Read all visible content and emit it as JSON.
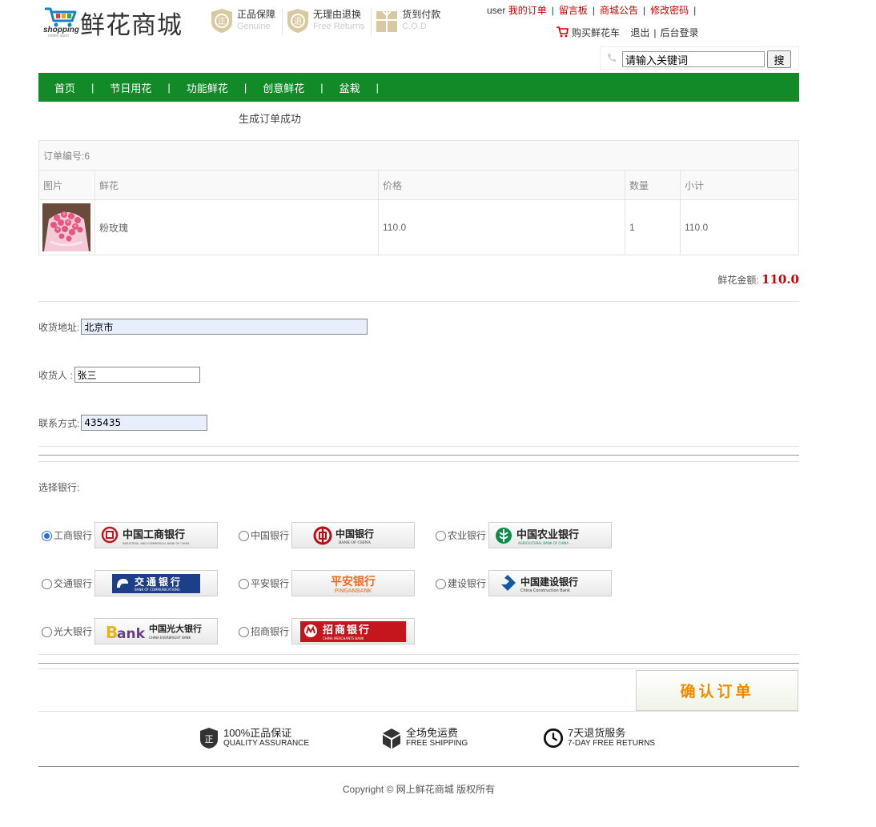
{
  "header": {
    "logo_word": "shopping",
    "logo_tag": "online sport",
    "brand": "鲜花商城",
    "promises": [
      {
        "title": "正品保障",
        "sub": "Genuine",
        "icon": "genuine-badge-icon"
      },
      {
        "title": "无理由退换",
        "sub": "Free Returns",
        "icon": "returns-badge-icon"
      },
      {
        "title": "货到付款",
        "sub": "C.O.D",
        "icon": "cod-badge-icon"
      }
    ],
    "username": "user",
    "top_links": [
      "我的订单",
      "留言板",
      "商城公告",
      "修改密码"
    ],
    "cart_link": "购买鲜花车",
    "logout": "退出",
    "admin": "后台登录",
    "search_value": "请输入关键词",
    "search_button": "搜"
  },
  "nav": [
    "首页",
    "节日用花",
    "功能鲜花",
    "创意鲜花",
    "盆栽"
  ],
  "order": {
    "success_msg": "生成订单成功",
    "order_no": "订单编号:6",
    "columns": [
      "图片",
      "鲜花",
      "价格",
      "数量",
      "小计"
    ],
    "items": [
      {
        "name": "粉玫瑰",
        "price": "110.0",
        "qty": "1",
        "subtotal": "110.0"
      }
    ],
    "total_label": "鲜花金额:",
    "total_value": "110.0"
  },
  "form": {
    "address_label": "收货地址:",
    "address_value": "北京市",
    "receiver_label": "收货人 :",
    "receiver_value": "张三",
    "contact_label": "联系方式:",
    "contact_value": "435435"
  },
  "banks": {
    "choose_label": "选择银行:",
    "list": [
      {
        "name": "工商银行",
        "selected": true,
        "logo": "icbc-logo",
        "logo_text": "中国工商银行",
        "logo_sub": "INDUSTRIAL AND COMMERCIAL BANK OF CHINA"
      },
      {
        "name": "中国银行",
        "selected": false,
        "logo": "boc-logo",
        "logo_text": "中国银行",
        "logo_sub": "BANK OF CHINA"
      },
      {
        "name": "农业银行",
        "selected": false,
        "logo": "abc-logo",
        "logo_text": "中国农业银行",
        "logo_sub": "AGRICULTURAL BANK OF CHINA"
      },
      {
        "name": "交通银行",
        "selected": false,
        "logo": "bocom-logo",
        "logo_text": "交通银行",
        "logo_sub": "BANK OF COMMUNICATIONS"
      },
      {
        "name": "平安银行",
        "selected": false,
        "logo": "pingan-logo",
        "logo_text": "平安银行",
        "logo_sub": "PINGANBANK"
      },
      {
        "name": "建设银行",
        "selected": false,
        "logo": "ccb-logo",
        "logo_text": "中国建设银行",
        "logo_sub": "China Construction Bank"
      },
      {
        "name": "光大银行",
        "selected": false,
        "logo": "ceb-logo",
        "logo_text": "中国光大银行",
        "logo_sub": "CHINA EVERBRIGHT BANK"
      },
      {
        "name": "招商银行",
        "selected": false,
        "logo": "cmb-logo",
        "logo_text": "招商银行",
        "logo_sub": "CHINA MERCHANTS BANK"
      }
    ]
  },
  "confirm_button": "确认订单",
  "services": [
    {
      "title": "100%正品保证",
      "sub": "QUALITY ASSURANCE",
      "icon": "quality-shield-icon"
    },
    {
      "title": "全场免运费",
      "sub": "FREE SHIPPING",
      "icon": "shipping-box-icon"
    },
    {
      "title": "7天退货服务",
      "sub": "7-DAY FREE RETURNS",
      "icon": "clock-icon"
    }
  ],
  "copyright": "Copyright © 网上鲜花商城 版权所有",
  "colors": {
    "nav_green": "#138a28",
    "accent_red": "#cc0000",
    "confirm_orange": "#ef8a00"
  }
}
